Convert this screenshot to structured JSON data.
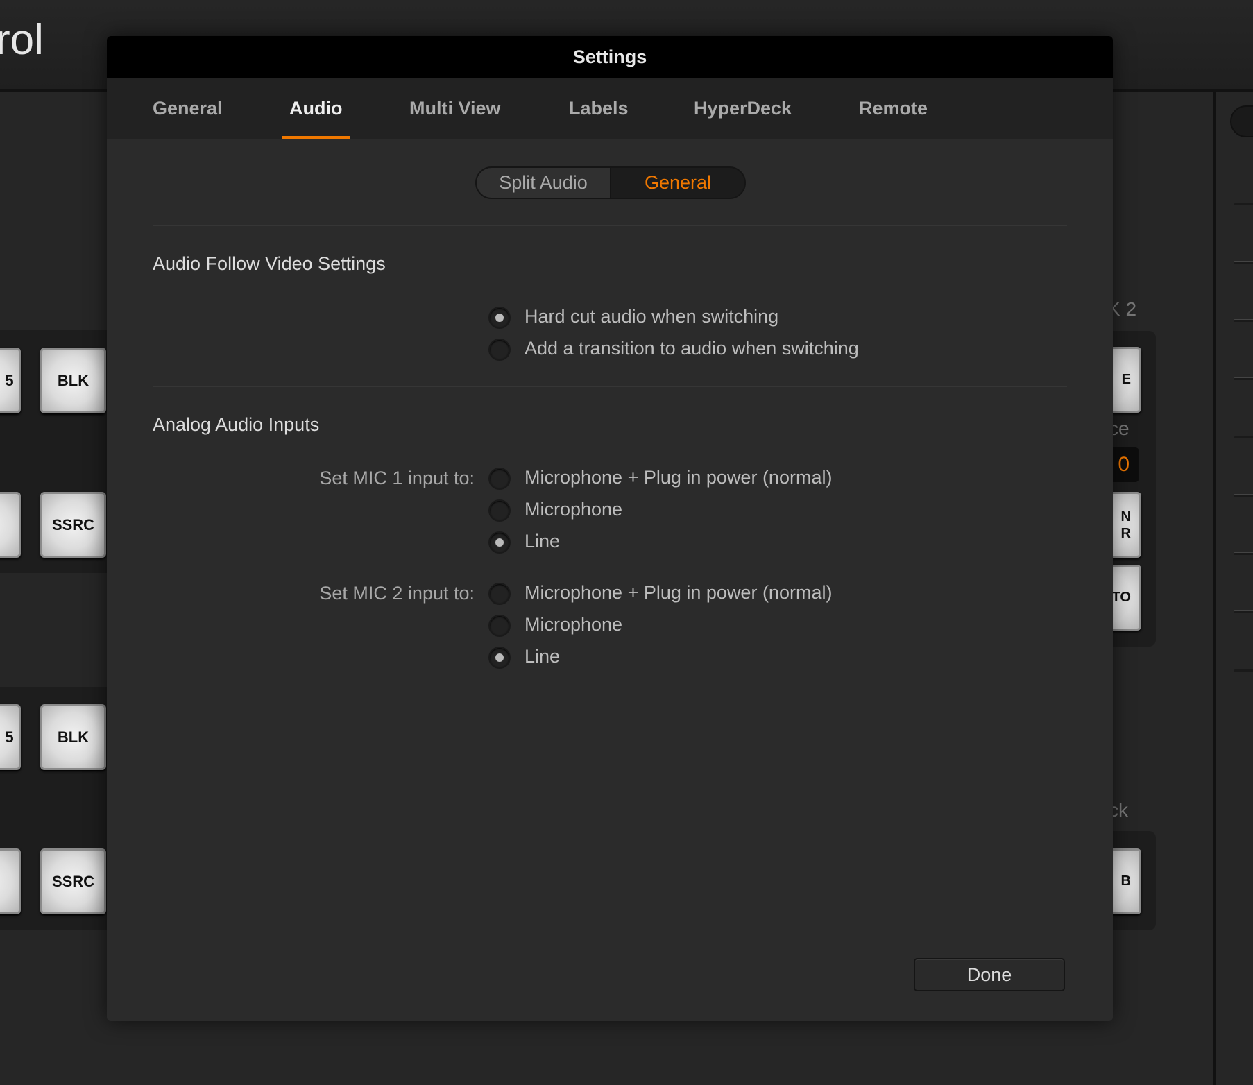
{
  "background": {
    "app_title_fragment": "rol",
    "left_buttons": [
      "BLK",
      "SSRC",
      "BLK",
      "SSRC"
    ],
    "left_partial_labels": [
      "5",
      "",
      "5",
      ""
    ],
    "right_labels": {
      "k2": "K 2",
      "ce": "ce",
      "value": "0",
      "ck": "ck"
    },
    "right_partial_buttons": [
      "E",
      "N\nR",
      "TO",
      "B"
    ]
  },
  "dialog": {
    "title": "Settings",
    "tabs": [
      {
        "label": "General"
      },
      {
        "label": "Audio",
        "active": true
      },
      {
        "label": "Multi View"
      },
      {
        "label": "Labels"
      },
      {
        "label": "HyperDeck"
      },
      {
        "label": "Remote"
      }
    ],
    "segments": [
      {
        "label": "Split Audio"
      },
      {
        "label": "General",
        "active": true
      }
    ],
    "afv": {
      "heading": "Audio Follow Video Settings",
      "options": [
        {
          "label": "Hard cut audio when switching",
          "selected": true
        },
        {
          "label": "Add a transition to audio when switching",
          "selected": false
        }
      ]
    },
    "analog": {
      "heading": "Analog Audio Inputs",
      "mic1": {
        "label": "Set MIC 1 input to:",
        "options": [
          {
            "label": "Microphone + Plug in power (normal)",
            "selected": false
          },
          {
            "label": "Microphone",
            "selected": false
          },
          {
            "label": "Line",
            "selected": true
          }
        ]
      },
      "mic2": {
        "label": "Set MIC 2 input to:",
        "options": [
          {
            "label": "Microphone + Plug in power (normal)",
            "selected": false
          },
          {
            "label": "Microphone",
            "selected": false
          },
          {
            "label": "Line",
            "selected": true
          }
        ]
      }
    },
    "done_label": "Done"
  },
  "colors": {
    "accent": "#f07800"
  }
}
